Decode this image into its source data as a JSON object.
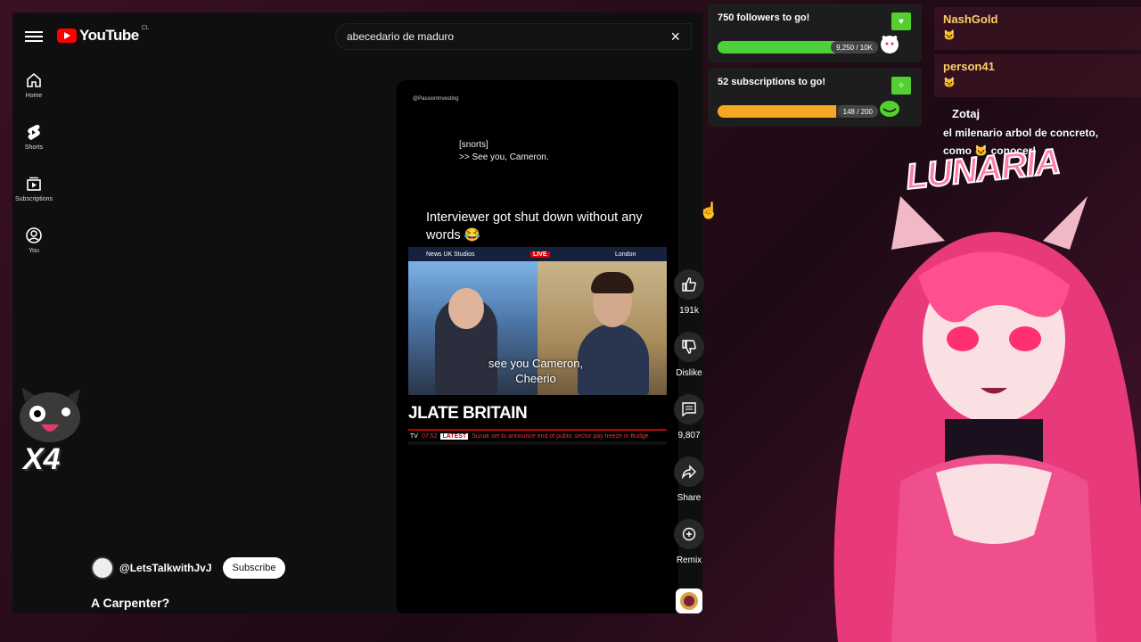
{
  "youtube": {
    "logo_word": "YouTube",
    "logo_region": "CL",
    "search_value": "abecedario de maduro",
    "clear_icon": "×",
    "sidebar": [
      {
        "label": "Home",
        "icon": "home-icon"
      },
      {
        "label": "Shorts",
        "icon": "shorts-icon"
      },
      {
        "label": "Subscriptions",
        "icon": "subscriptions-icon"
      },
      {
        "label": "You",
        "icon": "you-icon"
      }
    ],
    "short": {
      "watermark": "@PassionInvesting",
      "caption_line1": "[snorts]",
      "caption_line2": ">> See you, Cameron.",
      "headline": "Interviewer got shut down without any words 😂",
      "clip": {
        "studio": "News UK Studios",
        "live": "LIVE",
        "city": "London",
        "subtitle": "see you Cameron, Cheerio",
        "ticker_title": "JLATE BRITAIN",
        "channel_logo": "TV",
        "time": "07:52",
        "latest": "LATEST",
        "news": "Sunak set to announce end of public sector pay freeze in Budge"
      }
    },
    "actions": [
      {
        "label": "191k",
        "icon": "like-icon"
      },
      {
        "label": "Dislike",
        "icon": "dislike-icon"
      },
      {
        "label": "9,807",
        "icon": "comment-icon"
      },
      {
        "label": "Share",
        "icon": "share-icon"
      },
      {
        "label": "Remix",
        "icon": "remix-icon"
      }
    ],
    "channel_name": "@LetsTalkwithJvJ",
    "subscribe_label": "Subscribe",
    "short_title": "A Carpenter?"
  },
  "overlay": {
    "multiplier": "X4",
    "goals": [
      {
        "title": "750 followers to go!",
        "count": "9,250 / 10K",
        "progress": 0.925,
        "color": "#4cd13a"
      },
      {
        "title": "52 subscriptions to go!",
        "count": "148 / 200",
        "progress": 0.74,
        "color": "#f5a623"
      }
    ],
    "chat": [
      {
        "user": "NashGold",
        "badge": "🐱"
      },
      {
        "user": "person41",
        "badge": "🐱"
      }
    ],
    "chat_highlight": {
      "user": "Zotaj",
      "text": "el milenario arbol de concreto, como 🐱 conocer!"
    },
    "logo_text": "LUNARIA"
  }
}
